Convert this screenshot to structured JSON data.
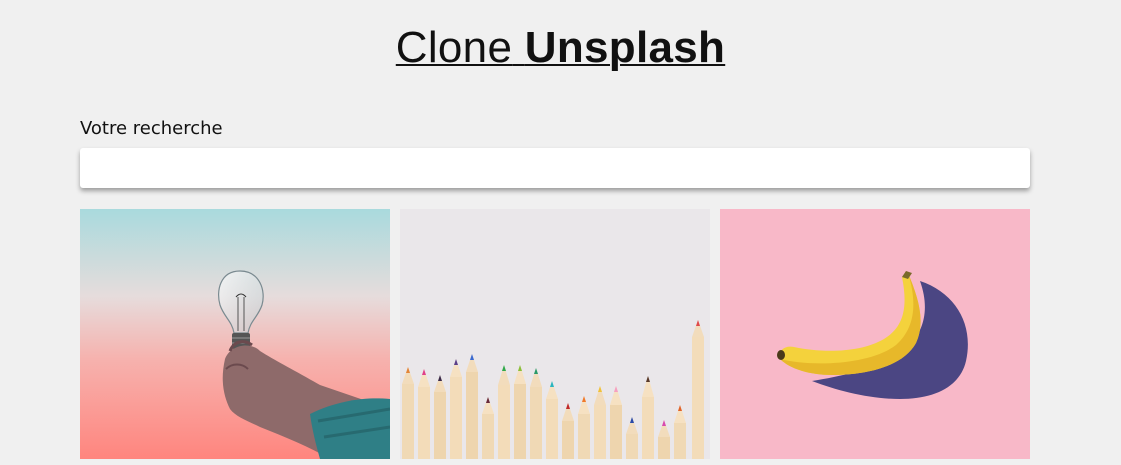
{
  "header": {
    "title_light": "Clone",
    "title_bold": "Unsplash"
  },
  "search": {
    "label": "Votre recherche",
    "value": "",
    "placeholder": ""
  },
  "gallery": {
    "photos": [
      {
        "subject": "hand holding light bulb",
        "colors": {
          "sky_top": "#a9dadd",
          "sky_bottom": "#ff857e",
          "sleeve": "#2f7f86"
        }
      },
      {
        "subject": "colored pencils",
        "colors": {
          "background": "#eae7ea",
          "wood": "#f0d9b5"
        }
      },
      {
        "subject": "banana",
        "colors": {
          "background": "#f8b8c8",
          "banana": "#f4d23c",
          "shadow": "#4b4683"
        }
      }
    ]
  }
}
